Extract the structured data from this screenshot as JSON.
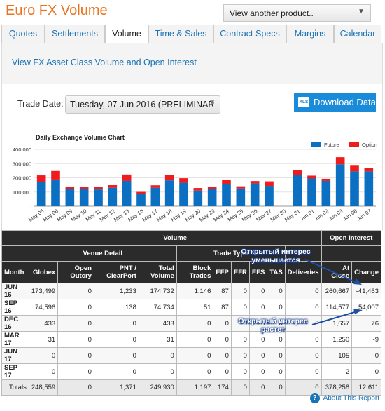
{
  "header": {
    "title": "Euro FX Volume",
    "product_select": "View another product.."
  },
  "tabs": [
    "Quotes",
    "Settlements",
    "Volume",
    "Time & Sales",
    "Contract Specs",
    "Margins",
    "Calendar"
  ],
  "active_tab": "Volume",
  "link": "View FX Asset Class Volume and Open Interest",
  "trade_date": {
    "label": "Trade Date:",
    "value": "Tuesday, 07 Jun 2016 (PRELIMINAR"
  },
  "download": {
    "icon_text": "XLS",
    "label": "Download Data"
  },
  "chart_data": {
    "type": "bar",
    "stacked": true,
    "title": "Daily Exchange Volume Chart",
    "categories": [
      "May 05",
      "May 06",
      "May 09",
      "May 10",
      "May 11",
      "May 12",
      "May 13",
      "May 16",
      "May 17",
      "May 18",
      "May 19",
      "May 20",
      "May 23",
      "May 24",
      "May 25",
      "May 26",
      "May 27",
      "May 30",
      "May 31",
      "Jun 01",
      "Jun 02",
      "Jun 03",
      "Jun 06",
      "Jun 07"
    ],
    "series": [
      {
        "name": "Future",
        "color": "#0b6fc2",
        "values": [
          172000,
          188000,
          123000,
          120000,
          118000,
          130000,
          178000,
          88000,
          130000,
          182000,
          165000,
          110000,
          120000,
          158000,
          125000,
          160000,
          143000,
          0,
          220000,
          195000,
          178000,
          295000,
          245000,
          245000
        ]
      },
      {
        "name": "Option",
        "color": "#ee1c1c",
        "values": [
          45000,
          60000,
          12000,
          18000,
          18000,
          18000,
          45000,
          13000,
          17000,
          40000,
          32000,
          18000,
          15000,
          25000,
          15000,
          17000,
          32000,
          0,
          35000,
          20000,
          15000,
          50000,
          45000,
          22000
        ]
      }
    ],
    "yticks": [
      "0",
      "100 000",
      "200 000",
      "300 000",
      "400 000"
    ],
    "ylim": [
      0,
      400000
    ],
    "legend_position": "top-right"
  },
  "table": {
    "group_headers": {
      "volume": "Volume",
      "open_interest": "Open Interest",
      "venue_detail": "Venue Detail",
      "trade_type": "Trade Type"
    },
    "columns": [
      "Month",
      "Globex",
      "Open Outcry",
      "PNT / ClearPort",
      "Total Volume",
      "Block Trades",
      "EFP",
      "EFR",
      "EFS",
      "TAS",
      "Deliveries",
      "At Close",
      "Change"
    ],
    "rows": [
      [
        "JUN 16",
        "173,499",
        "0",
        "1,233",
        "174,732",
        "1,146",
        "87",
        "0",
        "0",
        "0",
        "0",
        "260,667",
        "-41,463"
      ],
      [
        "SEP 16",
        "74,596",
        "0",
        "138",
        "74,734",
        "51",
        "87",
        "0",
        "0",
        "0",
        "0",
        "114,577",
        "54,007"
      ],
      [
        "DEC 16",
        "433",
        "0",
        "0",
        "433",
        "0",
        "0",
        "0",
        "0",
        "0",
        "0",
        "1,657",
        "76"
      ],
      [
        "MAR 17",
        "31",
        "0",
        "0",
        "31",
        "0",
        "0",
        "0",
        "0",
        "0",
        "0",
        "1,250",
        "-9"
      ],
      [
        "JUN 17",
        "0",
        "0",
        "0",
        "0",
        "0",
        "0",
        "0",
        "0",
        "0",
        "0",
        "105",
        "0"
      ],
      [
        "SEP 17",
        "0",
        "0",
        "0",
        "0",
        "0",
        "0",
        "0",
        "0",
        "0",
        "0",
        "2",
        "0"
      ]
    ],
    "totals": [
      "Totals",
      "248,559",
      "0",
      "1,371",
      "249,930",
      "1,197",
      "174",
      "0",
      "0",
      "0",
      "0",
      "378,258",
      "12,611"
    ]
  },
  "annotations": {
    "decrease": "Открытый интерес уменьшается",
    "increase": "Открытый интерес растет"
  },
  "about": {
    "icon_text": "?",
    "label": "About This Report"
  }
}
